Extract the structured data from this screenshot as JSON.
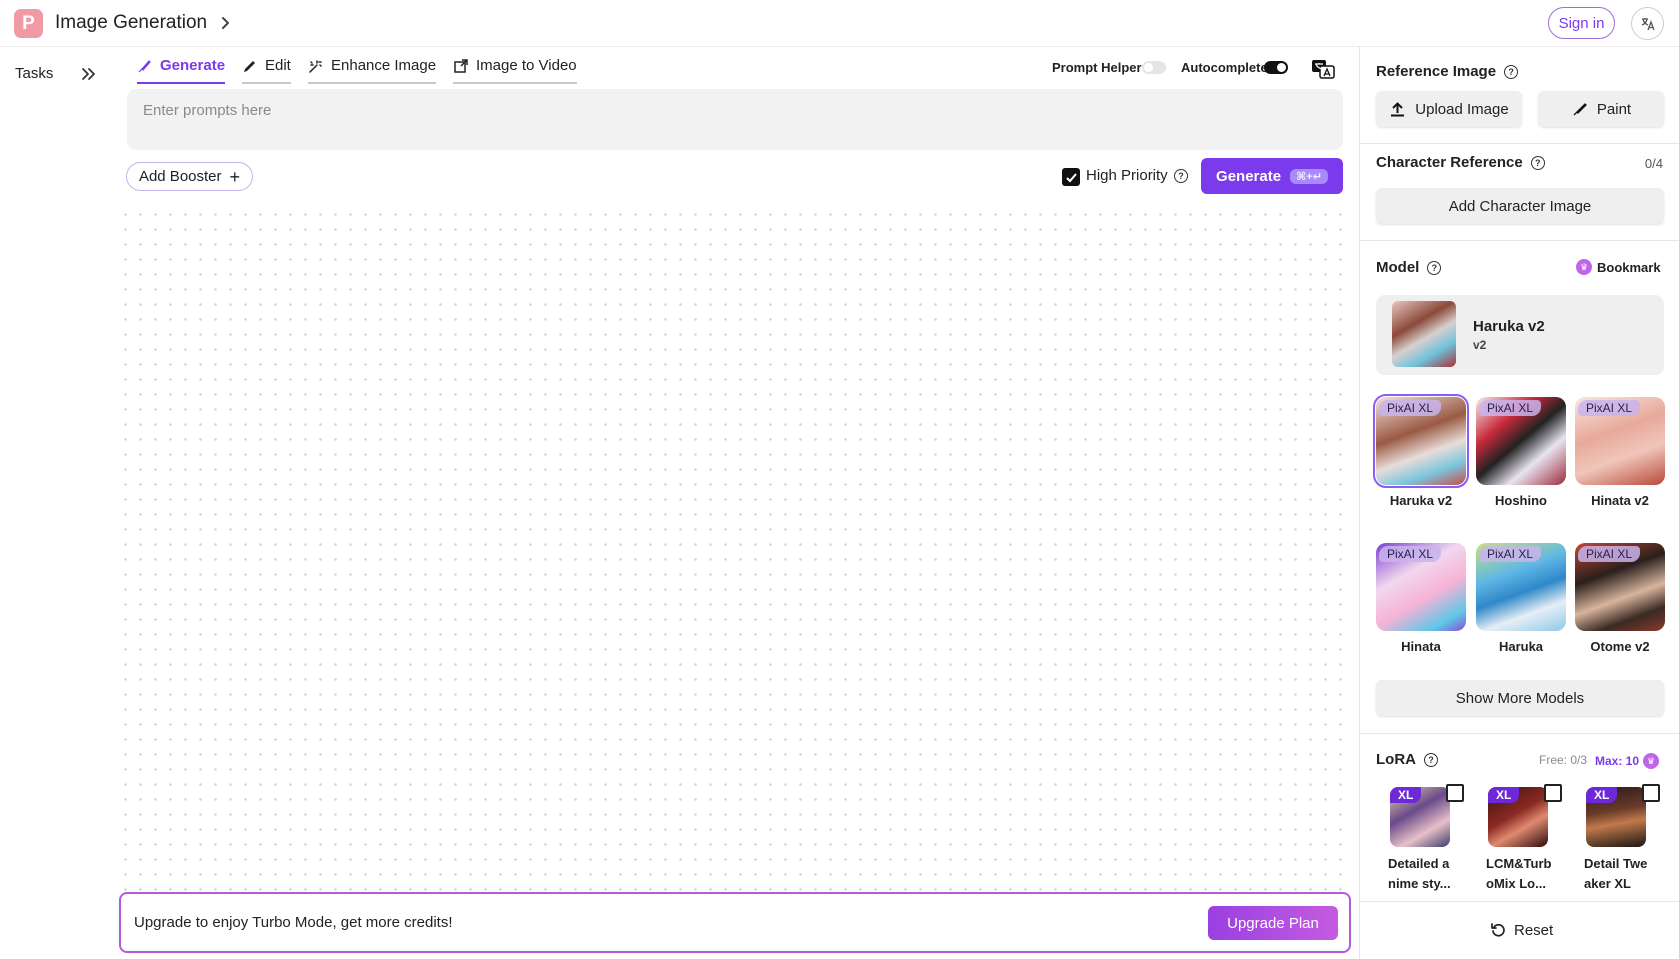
{
  "header": {
    "logo_letter": "P",
    "title": "Image Generation",
    "sign_in": "Sign in",
    "lang_icon": "translate-icon"
  },
  "sidebar": {
    "tasks_label": "Tasks"
  },
  "tabs": [
    {
      "label": "Generate",
      "icon": "brush-icon",
      "active": true
    },
    {
      "label": "Edit",
      "icon": "pencil-icon",
      "active": false
    },
    {
      "label": "Enhance Image",
      "icon": "sparkle-icon",
      "active": false
    },
    {
      "label": "Image to Video",
      "icon": "video-icon",
      "active": false
    }
  ],
  "options": {
    "prompt_helper": {
      "label": "Prompt Helper",
      "on": false
    },
    "autocomplete": {
      "label": "Autocomplete",
      "on": true
    }
  },
  "prompt": {
    "placeholder": "Enter prompts here",
    "value": ""
  },
  "booster": {
    "label": "Add Booster",
    "plus": "+"
  },
  "priority": {
    "label": "High Priority",
    "checked": true
  },
  "generate": {
    "label": "Generate",
    "shortcut": "⌘+↵"
  },
  "upgrade": {
    "text": "Upgrade to enjoy Turbo Mode, get more credits!",
    "button": "Upgrade Plan"
  },
  "panel": {
    "reference": {
      "title": "Reference Image",
      "upload": "Upload Image",
      "paint": "Paint"
    },
    "character": {
      "title": "Character Reference",
      "count": "0/4",
      "add": "Add Character Image"
    },
    "model": {
      "title": "Model",
      "bookmark": "Bookmark",
      "current": {
        "name": "Haruka v2",
        "version": "v2"
      },
      "tiles": [
        {
          "tag": "PixAI XL",
          "name": "Haruka v2",
          "selected": true
        },
        {
          "tag": "PixAI XL",
          "name": "Hoshino",
          "selected": false
        },
        {
          "tag": "PixAI XL",
          "name": "Hinata v2",
          "selected": false
        },
        {
          "tag": "PixAI XL",
          "name": "Hinata",
          "selected": false
        },
        {
          "tag": "PixAI XL",
          "name": "Haruka",
          "selected": false
        },
        {
          "tag": "PixAI XL",
          "name": "Otome v2",
          "selected": false
        }
      ],
      "show_more": "Show More Models"
    },
    "lora": {
      "title": "LoRA",
      "free": "Free: 0/3",
      "max": "Max: 10",
      "items": [
        {
          "tag": "XL",
          "name_line1": "Detailed a",
          "name_line2": "nime sty..."
        },
        {
          "tag": "XL",
          "name_line1": "LCM&Turb",
          "name_line2": "oMix Lo..."
        },
        {
          "tag": "XL",
          "name_line1": "Detail Twe",
          "name_line2": "aker XL"
        }
      ]
    },
    "reset": "Reset"
  },
  "colors": {
    "accent": "#7c3aed",
    "upgrade_border": "#b35bd9",
    "logo": "#f29aa4"
  }
}
